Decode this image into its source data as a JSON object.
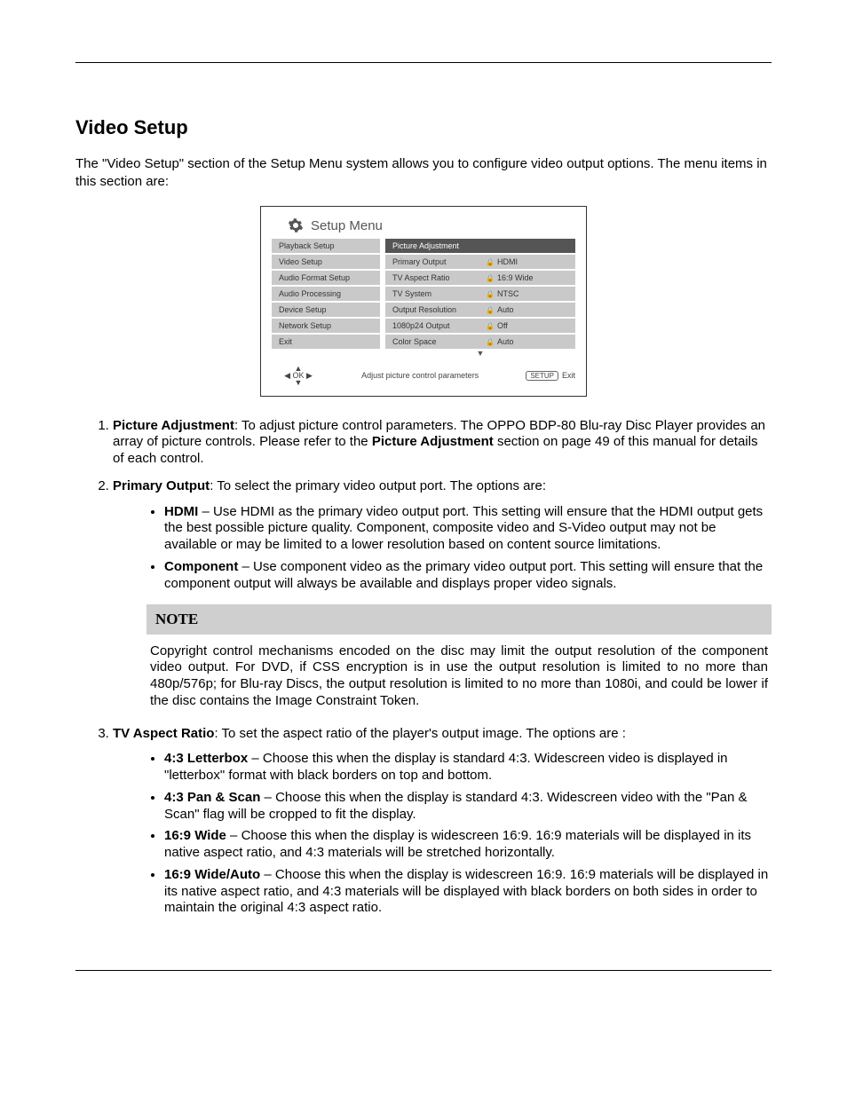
{
  "header_rule": true,
  "section_title": "Video Setup",
  "intro": "The \"Video Setup\" section of the Setup Menu system allows you to configure video output options.  The menu items in this section are:",
  "osd": {
    "title": "Setup Menu",
    "left": [
      "Playback Setup",
      "Video Setup",
      "Audio Format Setup",
      "Audio Processing",
      "Device Setup",
      "Network Setup",
      "Exit"
    ],
    "right": [
      {
        "label": "Picture Adjustment",
        "value": "",
        "selected": true
      },
      {
        "label": "Primary Output",
        "value": "HDMI"
      },
      {
        "label": "TV Aspect Ratio",
        "value": "16:9 Wide"
      },
      {
        "label": "TV System",
        "value": "NTSC"
      },
      {
        "label": "Output Resolution",
        "value": "Auto"
      },
      {
        "label": "1080p24 Output",
        "value": "Off"
      },
      {
        "label": "Color Space",
        "value": "Auto"
      }
    ],
    "hint": "Adjust picture control parameters",
    "exit_btn": "SETUP",
    "exit_lbl": "Exit"
  },
  "items": {
    "1": {
      "name": "Picture Adjustment",
      "desc_a": ": To adjust picture control parameters.  The OPPO BDP-80 Blu-ray Disc Player provides an array of picture controls.  Please refer to the ",
      "ref": "Picture Adjustment",
      "desc_b": " section on page 49 of this manual for details of each control."
    },
    "2": {
      "name": "Primary Output",
      "desc": ": To select the primary video output port.  The options are:",
      "opts": [
        {
          "name": "HDMI",
          "text": " – Use HDMI as the primary video output port.  This setting will ensure that the HDMI output gets the best possible picture quality.  Component, composite video and S-Video output may not be available or may be limited to a lower resolution based on content source limitations."
        },
        {
          "name": "Component",
          "text": " – Use component video as the primary video output port.  This setting will ensure that the component output will always be available and displays proper video signals."
        }
      ]
    },
    "3": {
      "name": "TV Aspect Ratio",
      "desc": ": To set the aspect ratio of the player's output image.  The options are :",
      "opts": [
        {
          "name": "4:3 Letterbox",
          "text": " – Choose this when the display is standard 4:3.  Widescreen video is displayed in \"letterbox\" format with black borders on top and bottom."
        },
        {
          "name": "4:3 Pan & Scan",
          "text": " – Choose this when the display is standard 4:3. Widescreen video with the \"Pan & Scan\" flag will be cropped to fit the display."
        },
        {
          "name": "16:9 Wide",
          "text": " – Choose this when the display is widescreen 16:9.  16:9 materials will be displayed in its native aspect ratio, and 4:3 materials will be stretched horizontally."
        },
        {
          "name": "16:9 Wide/Auto",
          "text": " – Choose this when the display is widescreen 16:9.  16:9 materials will be displayed in its native aspect ratio, and 4:3 materials will be displayed with black borders on both sides in order to maintain the original 4:3 aspect ratio."
        }
      ]
    }
  },
  "note": {
    "title": "NOTE",
    "body": "Copyright control mechanisms encoded on the disc may limit the output resolution of the component video output.  For DVD, if CSS encryption is in use the output resolution is limited to no more than 480p/576p; for Blu-ray Discs, the output resolution is limited to no more than 1080i, and could be lower if the disc contains the Image Constraint Token."
  }
}
